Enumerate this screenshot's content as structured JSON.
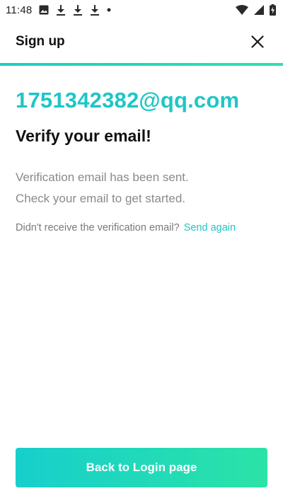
{
  "status_bar": {
    "time": "11:48",
    "left_icons": [
      "image-icon",
      "download-icon",
      "download-icon",
      "download-icon",
      "dot-icon"
    ],
    "right_icons": [
      "wifi-icon",
      "cellular-signal-icon",
      "battery-charging-icon"
    ]
  },
  "header": {
    "title": "Sign up",
    "close_icon": "close-icon"
  },
  "main": {
    "email": "1751342382@qq.com",
    "headline": "Verify your email!",
    "description_line1": "Verification email has been sent.",
    "description_line2": "Check your email to get started.",
    "resend_prompt": "Didn't receive the verification email?",
    "resend_link": "Send again"
  },
  "footer": {
    "back_button_label": "Back to Login page"
  },
  "colors": {
    "accent": "#1ec6c6",
    "gradient_start": "#17cfcc",
    "gradient_end": "#2be3a6",
    "text_primary": "#111111",
    "text_secondary": "#8a8a8a"
  }
}
